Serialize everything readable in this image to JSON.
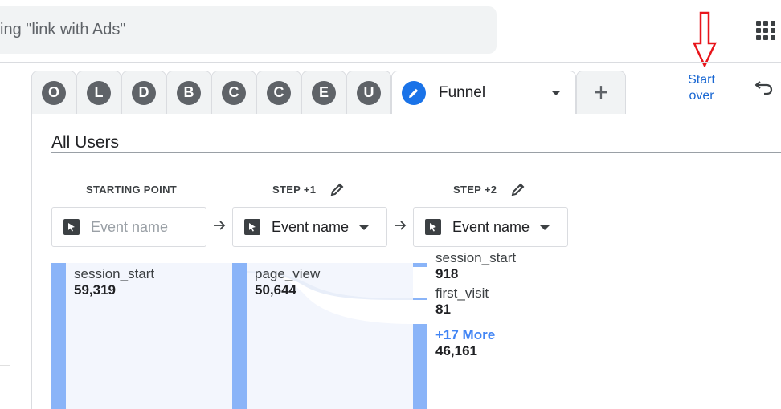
{
  "search": {
    "text": "ing \"link with Ads\""
  },
  "tabs": {
    "segments": [
      "O",
      "L",
      "D",
      "B",
      "C",
      "C",
      "E",
      "U"
    ],
    "active_name": "Funnel",
    "add_label": "+"
  },
  "actions": {
    "start_over": "Start over"
  },
  "segment": {
    "title": "All Users"
  },
  "steps": [
    {
      "label": "STARTING POINT",
      "event": "Event name"
    },
    {
      "label": "STEP +1",
      "event": "Event name"
    },
    {
      "label": "STEP +2",
      "event": "Event name"
    }
  ],
  "flow": {
    "start": {
      "name": "session_start",
      "value": "59,319"
    },
    "step1": {
      "name": "page_view",
      "value": "50,644"
    },
    "step2": [
      {
        "name": "session_start",
        "value": "918"
      },
      {
        "name": "first_visit",
        "value": "81"
      },
      {
        "name": "+17 More",
        "value": "46,161"
      }
    ]
  },
  "colors": {
    "accent": "#1a73e8",
    "bar": "#8ab4f8",
    "annotation": "#e8151b"
  }
}
